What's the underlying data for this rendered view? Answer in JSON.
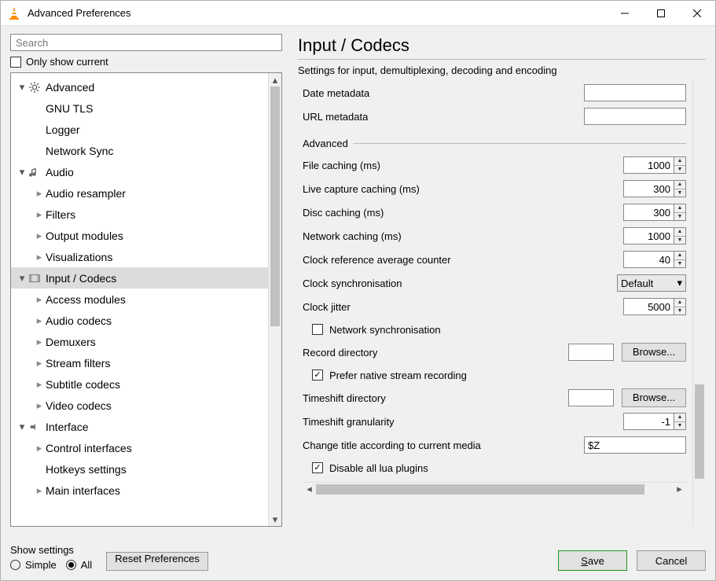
{
  "window": {
    "title": "Advanced Preferences"
  },
  "search": {
    "placeholder": "Search"
  },
  "only_show_current": {
    "label": "Only show current",
    "checked": false
  },
  "tree": {
    "items": [
      {
        "label": "Advanced",
        "depth": 0,
        "expanded": true,
        "icon": "gear-icon"
      },
      {
        "label": "GNU TLS",
        "depth": 1,
        "leaf": true
      },
      {
        "label": "Logger",
        "depth": 1,
        "leaf": true
      },
      {
        "label": "Network Sync",
        "depth": 1,
        "leaf": true
      },
      {
        "label": "Audio",
        "depth": 0,
        "expanded": true,
        "icon": "audio-icon"
      },
      {
        "label": "Audio resampler",
        "depth": 1,
        "expandable": true
      },
      {
        "label": "Filters",
        "depth": 1,
        "expandable": true
      },
      {
        "label": "Output modules",
        "depth": 1,
        "expandable": true
      },
      {
        "label": "Visualizations",
        "depth": 1,
        "expandable": true
      },
      {
        "label": "Input / Codecs",
        "depth": 0,
        "expanded": true,
        "icon": "codec-icon",
        "selected": true
      },
      {
        "label": "Access modules",
        "depth": 1,
        "expandable": true
      },
      {
        "label": "Audio codecs",
        "depth": 1,
        "expandable": true
      },
      {
        "label": "Demuxers",
        "depth": 1,
        "expandable": true
      },
      {
        "label": "Stream filters",
        "depth": 1,
        "expandable": true
      },
      {
        "label": "Subtitle codecs",
        "depth": 1,
        "expandable": true
      },
      {
        "label": "Video codecs",
        "depth": 1,
        "expandable": true
      },
      {
        "label": "Interface",
        "depth": 0,
        "expanded": true,
        "icon": "interface-icon"
      },
      {
        "label": "Control interfaces",
        "depth": 1,
        "expandable": true
      },
      {
        "label": "Hotkeys settings",
        "depth": 1,
        "leaf": true
      },
      {
        "label": "Main interfaces",
        "depth": 1,
        "expandable": true
      }
    ]
  },
  "page": {
    "title": "Input / Codecs",
    "description": "Settings for input, demultiplexing, decoding and encoding"
  },
  "fields": {
    "date_metadata": {
      "label": "Date metadata",
      "value": ""
    },
    "url_metadata": {
      "label": "URL metadata",
      "value": ""
    },
    "advanced_group": "Advanced",
    "file_caching": {
      "label": "File caching (ms)",
      "value": "1000"
    },
    "live_caching": {
      "label": "Live capture caching (ms)",
      "value": "300"
    },
    "disc_caching": {
      "label": "Disc caching (ms)",
      "value": "300"
    },
    "network_caching": {
      "label": "Network caching (ms)",
      "value": "1000"
    },
    "clock_ref_avg": {
      "label": "Clock reference average counter",
      "value": "40"
    },
    "clock_sync": {
      "label": "Clock synchronisation",
      "value": "Default"
    },
    "clock_jitter": {
      "label": "Clock jitter",
      "value": "5000"
    },
    "network_sync_chk": {
      "label": "Network synchronisation",
      "checked": false
    },
    "record_dir": {
      "label": "Record directory",
      "value": "",
      "browse": "Browse..."
    },
    "prefer_native": {
      "label": "Prefer native stream recording",
      "checked": true
    },
    "timeshift_dir": {
      "label": "Timeshift directory",
      "value": "",
      "browse": "Browse..."
    },
    "timeshift_gran": {
      "label": "Timeshift granularity",
      "value": "-1"
    },
    "change_title": {
      "label": "Change title according to current media",
      "value": "$Z"
    },
    "disable_lua": {
      "label": "Disable all lua plugins",
      "checked": true
    }
  },
  "footer": {
    "show_settings": "Show settings",
    "simple": "Simple",
    "all": "All",
    "reset": "Reset Preferences",
    "save": "Save",
    "cancel": "Cancel"
  }
}
